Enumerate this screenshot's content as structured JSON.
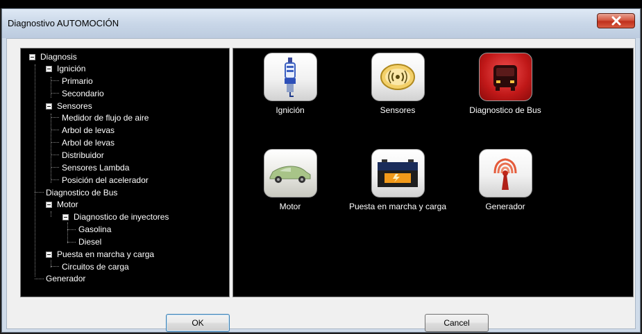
{
  "window": {
    "title": "Diagnostivo AUTOMOCIÓN",
    "close_icon": "close-x-icon"
  },
  "tree": {
    "nodes": [
      {
        "label": "Diagnosis",
        "expanded": true
      },
      {
        "label": "Ignición",
        "expanded": true
      },
      {
        "label": "Primario"
      },
      {
        "label": "Secondario"
      },
      {
        "label": "Sensores",
        "expanded": true
      },
      {
        "label": "Medidor de flujo de aire"
      },
      {
        "label": "Arbol de levas"
      },
      {
        "label": "Arbol de levas"
      },
      {
        "label": "Distribuidor"
      },
      {
        "label": "Sensores Lambda"
      },
      {
        "label": "Posición del acelerador"
      },
      {
        "label": "Diagnostico de Bus"
      },
      {
        "label": "Motor",
        "expanded": true
      },
      {
        "label": "Diagnostico de inyectores",
        "expanded": true
      },
      {
        "label": "Gasolina"
      },
      {
        "label": "Diesel"
      },
      {
        "label": "Puesta en marcha y carga",
        "expanded": true
      },
      {
        "label": "Circuitos de carga"
      },
      {
        "label": "Generador"
      }
    ]
  },
  "tiles": [
    {
      "label": "Ignición",
      "icon": "spark-plug-icon"
    },
    {
      "label": "Sensores",
      "icon": "sensor-signal-icon"
    },
    {
      "label": "Diagnostico de Bus",
      "icon": "bus-icon"
    },
    {
      "label": "Motor",
      "icon": "car-icon"
    },
    {
      "label": "Puesta en marcha y carga",
      "icon": "battery-icon"
    },
    {
      "label": "Generador",
      "icon": "antenna-signal-icon"
    }
  ],
  "buttons": {
    "ok": "OK",
    "cancel": "Cancel"
  }
}
